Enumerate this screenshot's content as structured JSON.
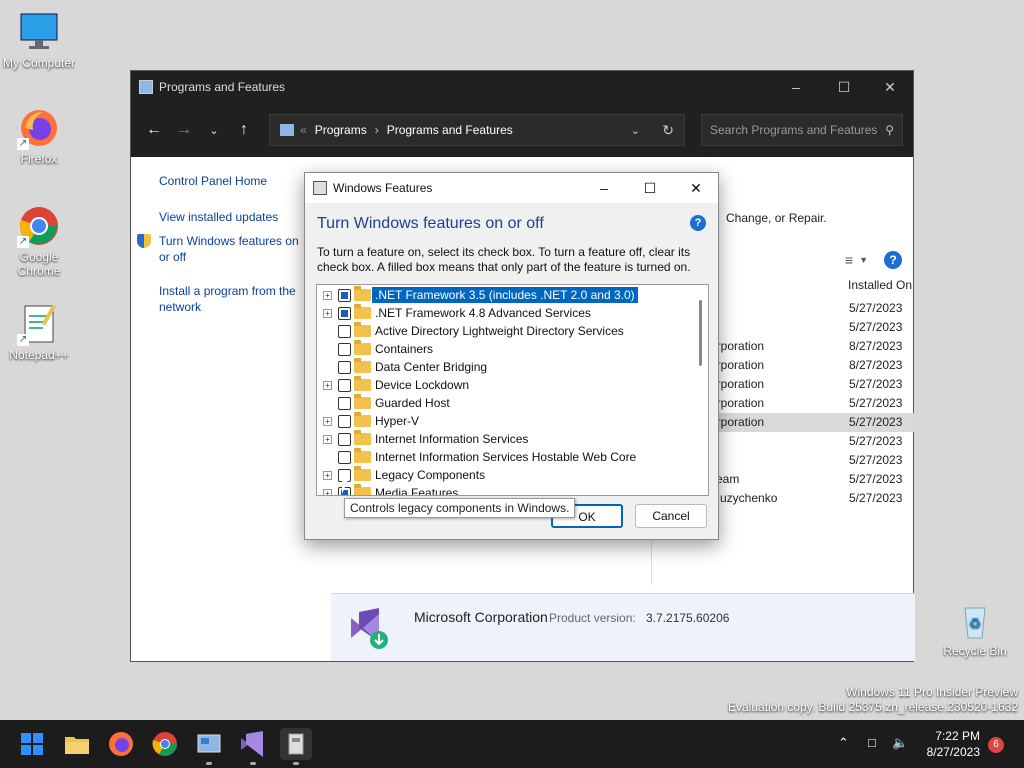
{
  "desktop": {
    "icons": [
      {
        "label": "My Computer"
      },
      {
        "label": "Firefox"
      },
      {
        "label": "Google Chrome"
      },
      {
        "label": "Notepad++"
      },
      {
        "label": "Recycle Bin"
      }
    ],
    "watermark": {
      "line1": "Windows 11 Pro Insider Preview",
      "line2": "Evaluation copy. Build 25375.zn_release.230520-1632"
    }
  },
  "programs_window": {
    "title": "Programs and Features",
    "breadcrumb": [
      "Programs",
      "Programs and Features"
    ],
    "search_placeholder": "Search Programs and Features",
    "left_links": {
      "home": "Control Panel Home",
      "updates": "View installed updates",
      "features": "Turn Windows features on or off",
      "install": "Install a program from the network"
    },
    "header_text": "Change, or Repair.",
    "column_installed_on": "Installed On",
    "rows": [
      {
        "publisher": "",
        "date": "5/27/2023"
      },
      {
        "publisher": "",
        "date": "5/27/2023"
      },
      {
        "publisher": "orporation",
        "date": "8/27/2023"
      },
      {
        "publisher": "orporation",
        "date": "8/27/2023"
      },
      {
        "publisher": "orporation",
        "date": "5/27/2023"
      },
      {
        "publisher": "orporation",
        "date": "5/27/2023"
      },
      {
        "publisher": "orporation",
        "date": "5/27/2023"
      },
      {
        "publisher": "",
        "date": "5/27/2023"
      },
      {
        "publisher": "",
        "date": "5/27/2023"
      },
      {
        "publisher": "Team",
        "date": "5/27/2023"
      },
      {
        "publisher": "Muzychenko",
        "date": "5/27/2023"
      }
    ],
    "details": {
      "publisher": "Microsoft Corporation",
      "product_version_label": "Product version:",
      "product_version": "3.7.2175.60206"
    }
  },
  "features_dialog": {
    "title": "Windows Features",
    "heading": "Turn Windows features on or off",
    "description": "To turn a feature on, select its check box. To turn a feature off, clear its check box. A filled box means that only part of the feature is turned on.",
    "items": [
      {
        "label": ".NET Framework 3.5 (includes .NET 2.0 and 3.0)"
      },
      {
        "label": ".NET Framework 4.8 Advanced Services"
      },
      {
        "label": "Active Directory Lightweight Directory Services"
      },
      {
        "label": "Containers"
      },
      {
        "label": "Data Center Bridging"
      },
      {
        "label": "Device Lockdown"
      },
      {
        "label": "Guarded Host"
      },
      {
        "label": "Hyper-V"
      },
      {
        "label": "Internet Information Services"
      },
      {
        "label": "Internet Information Services Hostable Web Core"
      },
      {
        "label": "Legacy Components"
      },
      {
        "label": "Media Features"
      }
    ],
    "tooltip": "Controls legacy components in Windows.",
    "ok_label": "OK",
    "cancel_label": "Cancel"
  },
  "taskbar": {
    "time": "7:22 PM",
    "date": "8/27/2023",
    "notification_count": "6"
  }
}
